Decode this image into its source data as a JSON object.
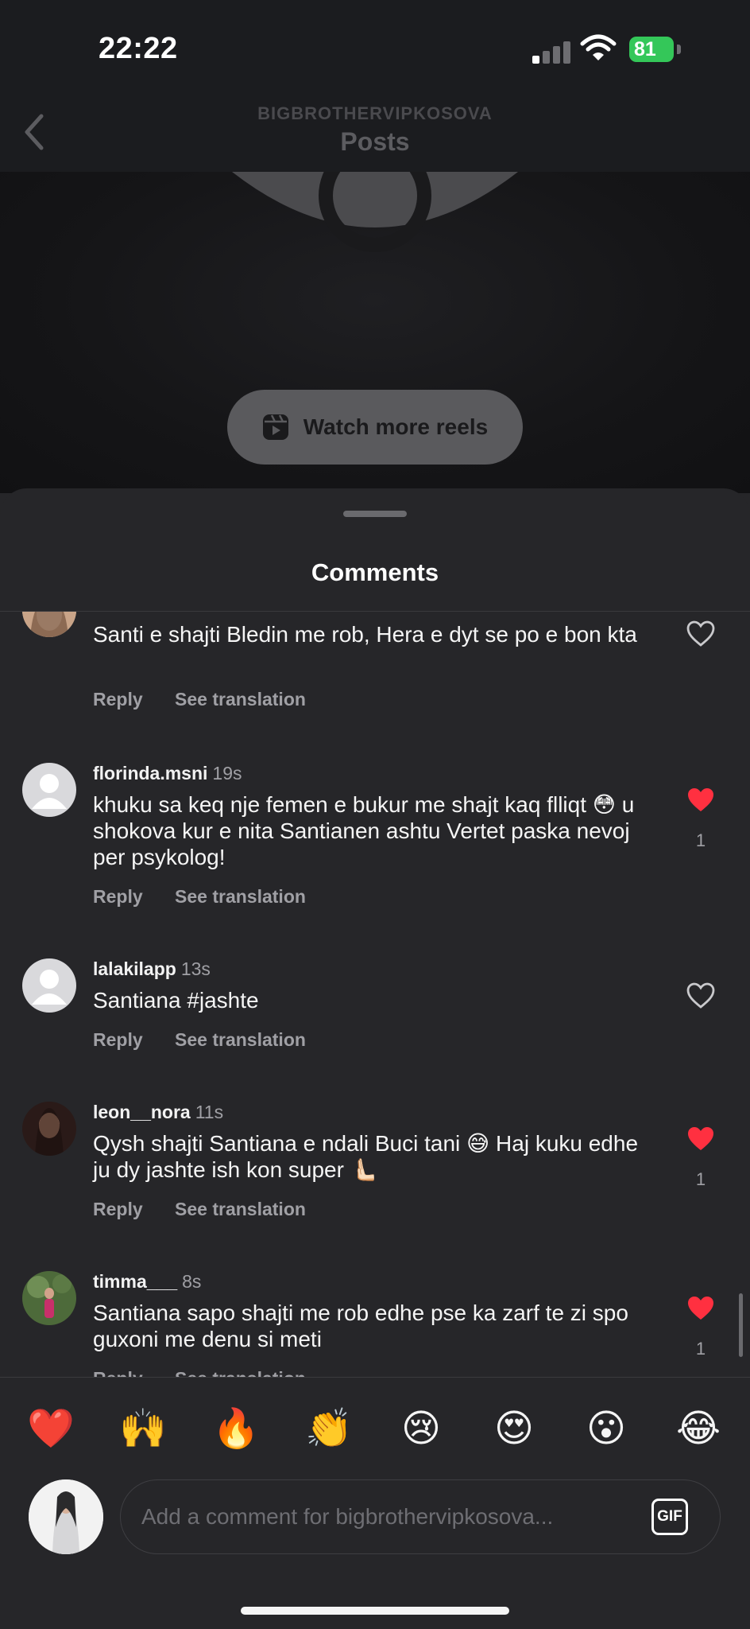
{
  "status_bar": {
    "time": "22:22",
    "battery": "81"
  },
  "nav": {
    "subtitle": "BIGBROTHERVIPKOSOVA",
    "title": "Posts"
  },
  "reel": {
    "watch_more_label": "Watch more reels"
  },
  "sheet": {
    "title": "Comments"
  },
  "comments": [
    {
      "username": "",
      "age": "",
      "text": "Santi e shajti Bledin me rob, Hera e dyt se po e bon kta",
      "reply": "Reply",
      "translate": "See translation",
      "liked": false,
      "likes": ""
    },
    {
      "username": "florinda.msni",
      "age": "19s",
      "text": "khuku sa keq nje femen e bukur me shajt kaq flliqt 😳 u shokova kur e nita Santianen ashtu  Vertet paska nevoj per psykolog!",
      "reply": "Reply",
      "translate": "See translation",
      "liked": true,
      "likes": "1"
    },
    {
      "username": "lalakilapp",
      "age": "13s",
      "text": "Santiana #jashte",
      "reply": "Reply",
      "translate": "See translation",
      "liked": false,
      "likes": ""
    },
    {
      "username": "leon__nora",
      "age": "11s",
      "text": "Qysh shajti Santiana e ndali Buci tani 😅 Haj kuku edhe ju dy jashte ish kon super 🫷🏻",
      "reply": "Reply",
      "translate": "See translation",
      "liked": true,
      "likes": "1"
    },
    {
      "username": "timma___",
      "age": "8s",
      "text": "Santiana sapo shajti me rob edhe pse ka zarf te zi spo guxoni me denu si meti",
      "reply": "Reply",
      "translate": "See translation",
      "liked": true,
      "likes": "1"
    }
  ],
  "emoji_bar": [
    "❤️",
    "🙌",
    "🔥",
    "👏",
    "😢",
    "😍",
    "😮",
    "😂"
  ],
  "composer": {
    "placeholder": "Add a comment for bigbrothervipkosova...",
    "gif_label": "GIF"
  },
  "colors": {
    "like_red": "#ff3040",
    "sheet_bg": "#262629",
    "battery_green": "#34c759"
  }
}
